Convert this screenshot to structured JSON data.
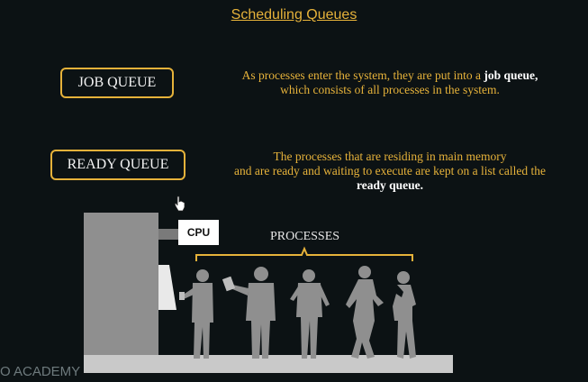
{
  "slide": {
    "title": "Scheduling Queues",
    "job_queue": {
      "label": "JOB QUEUE",
      "description_pre": "As processes enter the system, they are put into a",
      "description_bold": "job queue,",
      "description_post": "which consists of all processes in the system."
    },
    "ready_queue": {
      "label": "READY QUEUE",
      "description_line1": "The processes that are residing in main memory",
      "description_line2": "and are ready and waiting to execute are kept on a list called the",
      "description_bold": "ready queue."
    },
    "diagram": {
      "cpu_label": "CPU",
      "processes_label": "PROCESSES"
    },
    "watermark": "O ACADEMY"
  },
  "colors": {
    "background": "#0c1214",
    "accent": "#e6b23a",
    "silhouette": "#8f8f8f",
    "floor": "#c9c9c9"
  },
  "icons": [
    "mouse-cursor-icon",
    "person-silhouette-icon"
  ]
}
